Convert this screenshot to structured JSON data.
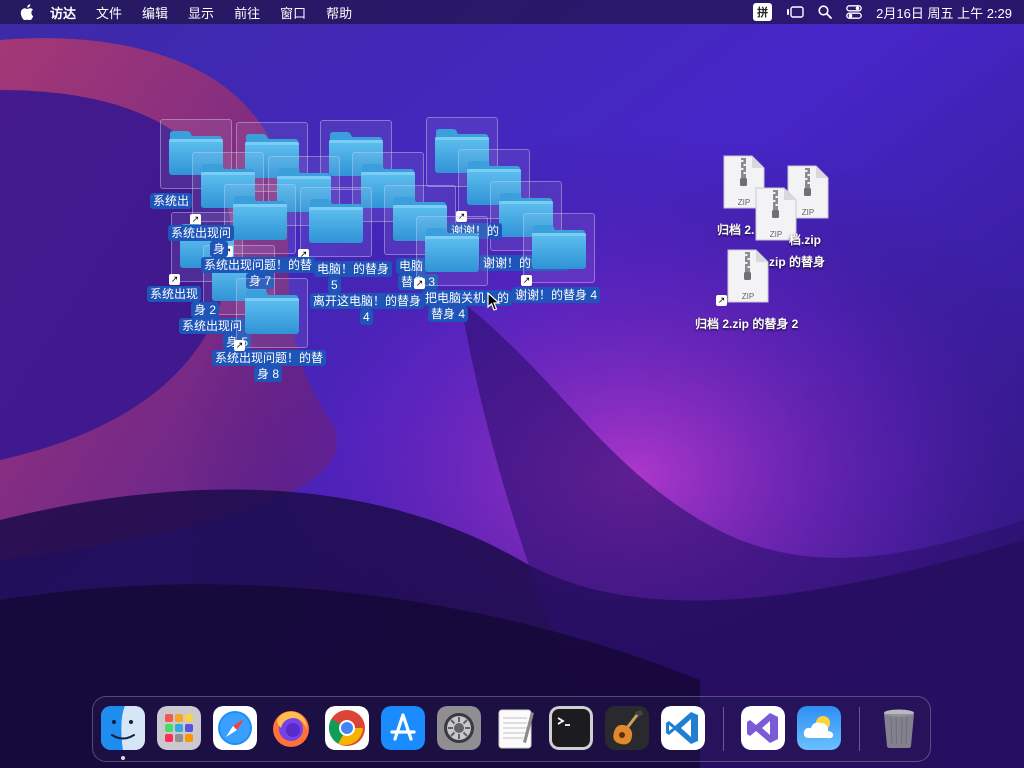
{
  "menubar": {
    "app_name": "访达",
    "items": [
      "文件",
      "编辑",
      "显示",
      "前往",
      "窗口",
      "帮助"
    ],
    "input_method": "拼",
    "clock": "2月16日 周五 上午 2:29"
  },
  "desktop": {
    "folder_labels": {
      "l1": "系统出",
      "l2": "系统出现问",
      "l2b": "身",
      "l3": "系统出现问题！的替",
      "l3b": "身 7",
      "l4": "系统出现",
      "l4b": "身 2",
      "l5": "系统出现问",
      "l5b": "身 5",
      "l6": "系统出现问题！的替",
      "l6b": "身 8",
      "l7": "电脑！的替身",
      "l7b": "5",
      "l8": "离开这电脑！的替身",
      "l8b": "4",
      "l9": "电脑",
      "l9b": "替身 3",
      "l10": "把电脑关机！的",
      "l10b": "替身 4",
      "l11": "谢谢！的替身 5",
      "l12": "谢谢！的替身 4",
      "l13": "谢谢！的"
    },
    "zip_labels": {
      "z1": "归档 2.",
      "z2": "档.zip",
      "z3": "zip 的替身",
      "z4": "归档 2.zip 的替身 2"
    },
    "zip_text": "ZIP"
  },
  "dock": {
    "apps": [
      "finder",
      "launchpad",
      "safari",
      "firefox",
      "chrome",
      "app-store",
      "system-settings",
      "textedit",
      "terminal",
      "garageband",
      "vscode",
      "visual-studio",
      "weather",
      "trash"
    ]
  },
  "colors": {
    "label_bg": "#1f54b8",
    "folder_blue": "#3aa6e4",
    "folder_tab": "#57b9ec"
  }
}
